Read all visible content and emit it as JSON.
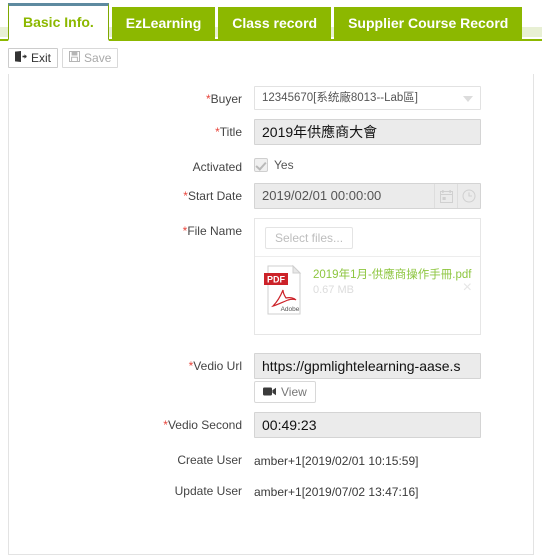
{
  "tabs": [
    {
      "label": "Basic Info.",
      "active": true
    },
    {
      "label": "EzLearning",
      "active": false
    },
    {
      "label": "Class record",
      "active": false
    },
    {
      "label": "Supplier Course Record",
      "active": false
    }
  ],
  "toolbar": {
    "exit_label": "Exit",
    "save_label": "Save"
  },
  "form": {
    "buyer": {
      "label": "Buyer",
      "required": true,
      "value": "12345670[系统廠8013--Lab區]"
    },
    "title": {
      "label": "Title",
      "required": true,
      "value": "2019年供應商大會"
    },
    "activated": {
      "label": "Activated",
      "required": false,
      "checked": true,
      "option_label": "Yes"
    },
    "start_date": {
      "label": "Start Date",
      "required": true,
      "value": "2019/02/01 00:00:00"
    },
    "file_name": {
      "label": "File Name",
      "required": true,
      "select_files_placeholder": "Select files...",
      "file": {
        "name": "2019年1月-供應商操作手冊.pdf",
        "size": "0.67 MB",
        "type": "PDF",
        "remove_label": "×"
      }
    },
    "vedio_url": {
      "label": "Vedio Url",
      "required": true,
      "value": "https://gpmlightelearning-aase.s",
      "view_label": "View"
    },
    "vedio_second": {
      "label": "Vedio Second",
      "required": true,
      "value": "00:49:23"
    },
    "create_user": {
      "label": "Create User",
      "required": false,
      "value": "amber+1[2019/02/01 10:15:59]"
    },
    "update_user": {
      "label": "Update User",
      "required": false,
      "value": "amber+1[2019/07/02 13:47:16]"
    }
  },
  "colors": {
    "tab_green": "#8cb800",
    "active_tab_text": "#8cb800",
    "required_star": "#e8453c",
    "file_link": "#8dc63f",
    "pdf_red": "#cc2229"
  }
}
